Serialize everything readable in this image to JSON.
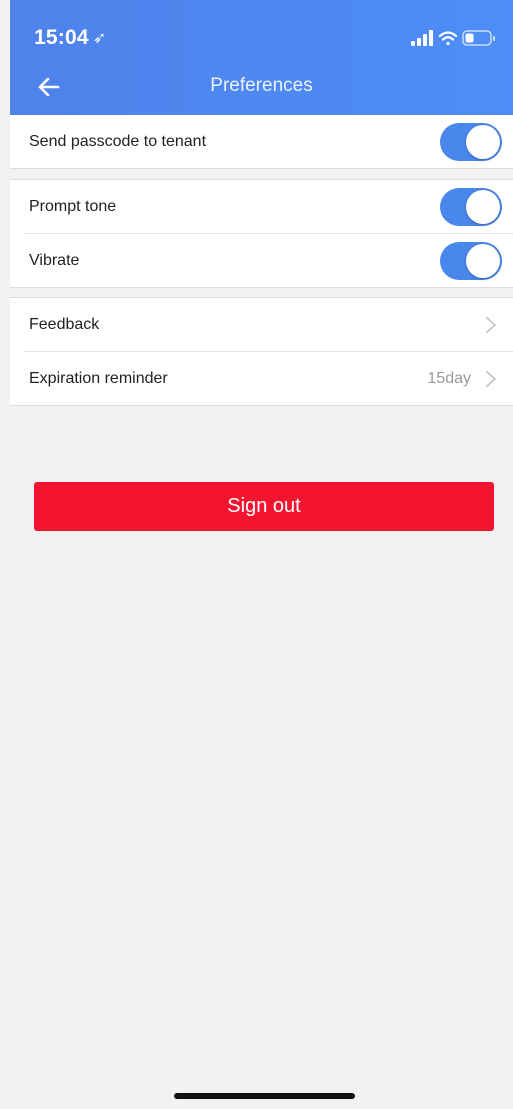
{
  "status_bar": {
    "time": "15:04",
    "location_icon": "location-arrow-icon",
    "signal_icon": "cellular-signal-icon",
    "wifi_icon": "wifi-icon",
    "battery_icon": "battery-icon"
  },
  "header": {
    "title": "Preferences",
    "back_icon": "back-arrow-icon",
    "color": "#4e86f0"
  },
  "settings": {
    "send_passcode": {
      "label": "Send passcode to tenant",
      "enabled": true
    },
    "prompt_tone": {
      "label": "Prompt tone",
      "enabled": true
    },
    "vibrate": {
      "label": "Vibrate",
      "enabled": true
    },
    "feedback": {
      "label": "Feedback"
    },
    "expiration_reminder": {
      "label": "Expiration reminder",
      "value": "15day"
    }
  },
  "sign_out": {
    "label": "Sign out",
    "color": "#f31530"
  },
  "toggle_color": "#4a87ec"
}
